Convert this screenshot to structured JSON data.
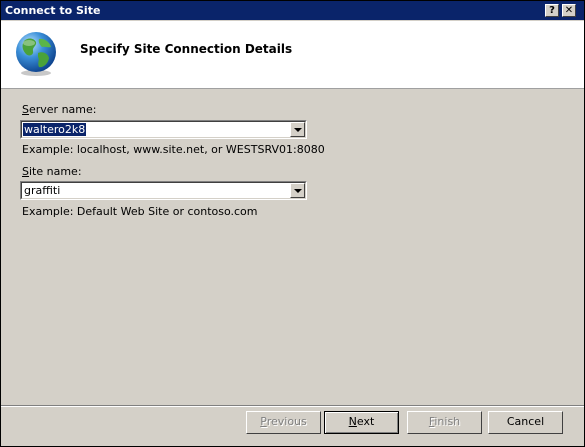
{
  "window": {
    "title": "Connect to Site",
    "help_button": "?",
    "close_button": "✕"
  },
  "header": {
    "title": "Specify Site Connection Details",
    "icon": "globe-icon"
  },
  "server": {
    "label_mnemonic": "S",
    "label_rest": "erver name:",
    "value": "waltero2k8",
    "example": "Example: localhost, www.site.net, or WESTSRV01:8080"
  },
  "site": {
    "label_mnemonic": "S",
    "label_rest": "ite name:",
    "value": "graffiti",
    "example": "Example: Default Web Site or contoso.com"
  },
  "buttons": {
    "previous_mnemonic": "P",
    "previous_rest": "revious",
    "next_mnemonic": "N",
    "next_rest": "ext",
    "finish_mnemonic": "F",
    "finish_rest": "inish",
    "cancel": "Cancel"
  },
  "colors": {
    "titlebar": "#0a246a",
    "dialog_bg": "#d4d0c8",
    "selection": "#0a246a"
  }
}
